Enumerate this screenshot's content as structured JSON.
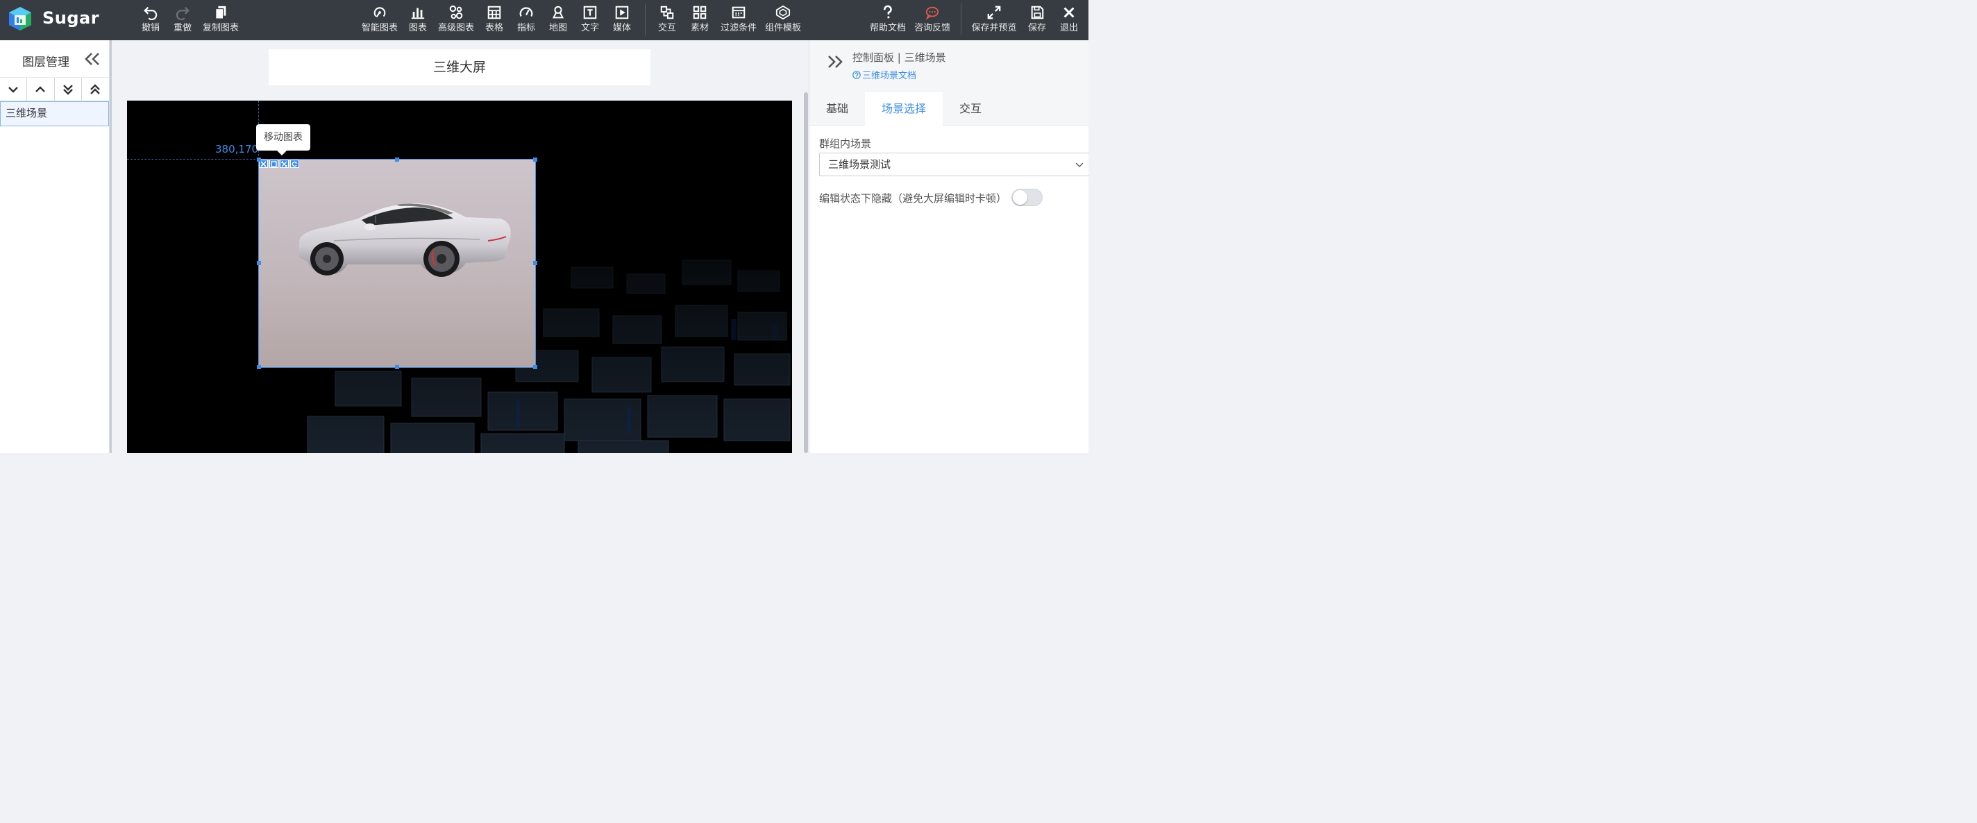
{
  "app": {
    "name": "Sugar"
  },
  "toolbar": {
    "left": [
      {
        "label": "撤销",
        "icon": "undo-icon"
      },
      {
        "label": "重做",
        "icon": "redo-icon"
      },
      {
        "label": "复制图表",
        "icon": "copy-icon"
      }
    ],
    "center": [
      {
        "label": "智能图表",
        "icon": "smart-chart-icon"
      },
      {
        "label": "图表",
        "icon": "bar-chart-icon"
      },
      {
        "label": "高级图表",
        "icon": "advanced-chart-icon"
      },
      {
        "label": "表格",
        "icon": "table-icon"
      },
      {
        "label": "指标",
        "icon": "gauge-icon"
      },
      {
        "label": "地图",
        "icon": "map-pin-icon"
      },
      {
        "label": "文字",
        "icon": "text-icon"
      },
      {
        "label": "媒体",
        "icon": "media-play-icon"
      },
      {
        "label": "交互",
        "icon": "interaction-icon"
      },
      {
        "label": "素材",
        "icon": "material-grid-icon"
      },
      {
        "label": "过滤条件",
        "icon": "filter-icon"
      },
      {
        "label": "组件模板",
        "icon": "component-template-icon"
      }
    ],
    "right": [
      {
        "label": "帮助文档",
        "icon": "help-icon"
      },
      {
        "label": "咨询反馈",
        "icon": "feedback-icon"
      },
      {
        "label": "保存并预览",
        "icon": "expand-icon"
      },
      {
        "label": "保存",
        "icon": "save-icon"
      },
      {
        "label": "退出",
        "icon": "close-icon"
      }
    ]
  },
  "layers": {
    "title": "图层管理",
    "items": [
      "三维场景"
    ]
  },
  "canvas": {
    "screen_title": "三维大屏",
    "coordinate_readout": "380,170",
    "tooltip": "移动图表"
  },
  "control_panel": {
    "title": "控制面板 | 三维场景",
    "doc_link": "三维场景文档",
    "tabs": [
      {
        "label": "基础",
        "active": false
      },
      {
        "label": "场景选择",
        "active": true
      },
      {
        "label": "交互",
        "active": false
      }
    ],
    "scene_label": "群组内场景",
    "scene_value": "三维场景测试",
    "hide_label": "编辑状态下隐藏（避免大屏编辑时卡顿）",
    "hide_enabled": false
  },
  "colors": {
    "toolbar_bg": "#363c42",
    "accent": "#3b8de6",
    "feedback_icon": "#e05a4f"
  }
}
